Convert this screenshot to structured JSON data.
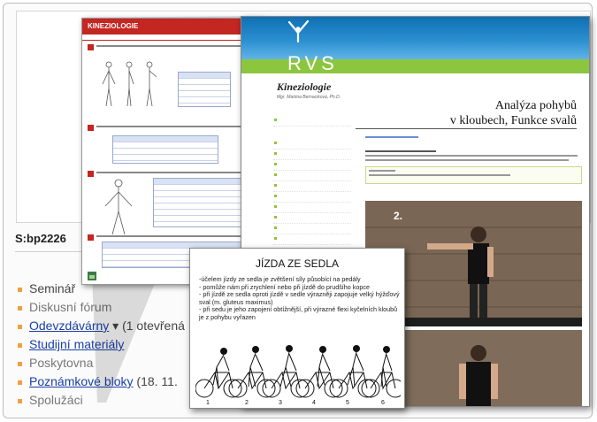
{
  "course_page": {
    "code": "S:bp2226",
    "menu": [
      {
        "prefix": "Seminář",
        "label": "",
        "suffix": "",
        "link": false
      },
      {
        "prefix": "",
        "label": "Diskusní fórum",
        "suffix": "",
        "link": false
      },
      {
        "prefix": "",
        "label": "Odevzdávárny",
        "suffix": "▾ (1 otevřená",
        "link": true
      },
      {
        "prefix": "",
        "label": "Studijní materiály",
        "suffix": "",
        "link": true
      },
      {
        "prefix": "",
        "label": "Poskytovna",
        "suffix": "",
        "link": false
      },
      {
        "prefix": "",
        "label": "Poznámkové bloky",
        "suffix": "(18. 11.",
        "link": true
      },
      {
        "prefix": "",
        "label": "Spolužáci",
        "suffix": "",
        "link": false
      }
    ]
  },
  "worksheet": {
    "title": "KINEZIOLOGIE"
  },
  "rvs_page": {
    "logo": "RVS",
    "course_title": "Kineziologie",
    "author": "Mgr. Martina Bernaciková, Ph.D.",
    "heading_line1": "Analýza pohybů",
    "heading_line2": "v kloubech, Funkce svalů",
    "video_number": "2."
  },
  "slide": {
    "title": "JÍZDA ZE SEDLA",
    "lines": [
      "-účelem jízdy ze sedla je zvětšení síly působící na pedály",
      "- pomůže nám při zrychlení nebo při jízdě do prudšího kopce",
      "- při jízdě ze sedla oproti jízdě v sedle výrazněji zapojuje velký hýžďový sval (m. gluteus maximus)",
      "- při sedu je jeho zapojení obtížnější, při výrazné flexi kyčelních kloubů je z pohybu vyřazen"
    ],
    "bike_numbers": [
      "1",
      "2",
      "3",
      "4",
      "5",
      "6"
    ]
  }
}
